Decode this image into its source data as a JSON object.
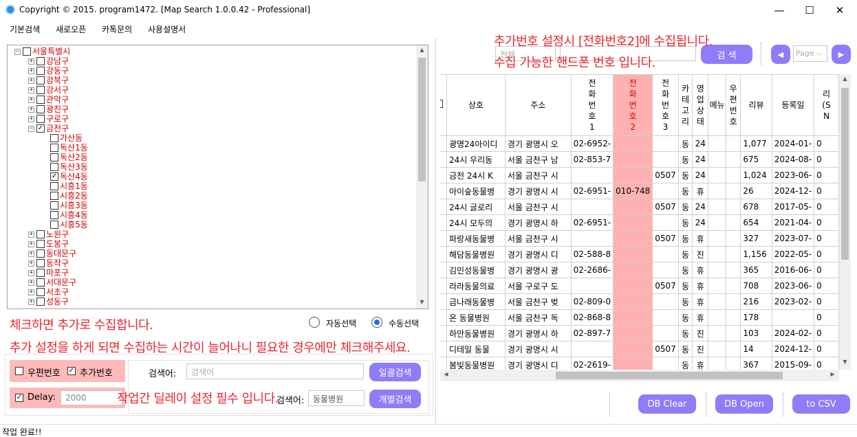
{
  "window": {
    "title": "Copyright © 2015. program1472. [Map Search 1.0.0.42 - Professional]",
    "minimize": "—",
    "maximize": "☐",
    "close": "✕"
  },
  "menu": [
    "기본검색",
    "새로오픈",
    "카톡문의",
    "사용설명서"
  ],
  "tree": {
    "root": "서울특별시",
    "districts_top": [
      "강남구",
      "강동구",
      "강북구",
      "강서구",
      "관악구",
      "광진구",
      "구로구"
    ],
    "open_district": "금천구",
    "dongs": [
      {
        "label": "가산동",
        "checked": false
      },
      {
        "label": "독산1동",
        "checked": false
      },
      {
        "label": "독산2동",
        "checked": false
      },
      {
        "label": "독산3동",
        "checked": false
      },
      {
        "label": "독산4동",
        "checked": true
      },
      {
        "label": "시흥1동",
        "checked": false
      },
      {
        "label": "시흥2동",
        "checked": false
      },
      {
        "label": "시흥3동",
        "checked": false
      },
      {
        "label": "시흥4동",
        "checked": false
      },
      {
        "label": "시흥5동",
        "checked": false
      }
    ],
    "districts_bottom": [
      "노원구",
      "도봉구",
      "동대문구",
      "동작구",
      "마포구",
      "서대문구",
      "서초구",
      "성동구"
    ]
  },
  "selection_mode": {
    "auto": "자동선택",
    "manual": "수동선택",
    "selected": "manual"
  },
  "options": {
    "postal_label": "우편번호",
    "postal_checked": false,
    "extra_label": "추가번호",
    "extra_checked": true,
    "delay_label": "Delay:",
    "delay_value": "2000",
    "delay_checked": true
  },
  "search": {
    "keyword_label": "검색어:",
    "keyword_placeholder": "검색어",
    "batch_button": "일괄검색",
    "individual_label": "검색어:",
    "individual_value": "동물병원",
    "individual_button": "개별검색"
  },
  "top_search": {
    "select_value": "전체",
    "input_placeholder": "",
    "search_button": "검  색",
    "page_select": "Page",
    "prev": "◀",
    "next": "▶"
  },
  "annotations": {
    "top_line1": "추가번호 설정시 [전화번호2]에 수집됩니다.",
    "top_line2": "수집 가능한 핸드폰 번호 입니다.",
    "check_line1": "체크하면 추가로 수집합니다.",
    "check_line2": "추가 설정을 하게 되면 수집하는 시간이 늘어나니 필요한 경우에만 체크해주세요.",
    "delay_line": "작업간 딜레이 설정 필수 입니다."
  },
  "grid": {
    "headers": [
      "",
      "상호",
      "주소",
      "전화번호1",
      "전화번호2",
      "전화번호3",
      "카테고리",
      "영업상태",
      "메뉴",
      "우편번호",
      "리뷰",
      "등록일",
      "리(SN"
    ],
    "rows": [
      [
        "광명24아이디",
        "경기 광명시 오",
        "02-6952-",
        "",
        "",
        "동",
        "24",
        "",
        "",
        "1,077",
        "2024-01-",
        "0"
      ],
      [
        "24시 우리동",
        "서울 금천구 남",
        "02-853-7",
        "",
        "",
        "동",
        "24",
        "",
        "",
        "675",
        "2024-08-",
        "0"
      ],
      [
        "금천 24시 K",
        "서울 금천구 시",
        "",
        "",
        "0507",
        "동",
        "24",
        "",
        "",
        "1,024",
        "2023-06-",
        "0"
      ],
      [
        "아이숲동물병",
        "경기 광명시 시",
        "02-6951-",
        "010-748",
        "",
        "동",
        "휴",
        "",
        "",
        "26",
        "2024-12-",
        "0"
      ],
      [
        "24시 글로리",
        "서울 금천구 시",
        "",
        "",
        "0507",
        "동",
        "24",
        "",
        "",
        "678",
        "2017-05-",
        "0"
      ],
      [
        "24시 모두의",
        "경기 광명시 하",
        "02-6951-",
        "",
        "",
        "동",
        "24",
        "",
        "",
        "654",
        "2021-04-",
        "0"
      ],
      [
        "파랑새동물병",
        "서울 금천구 시",
        "",
        "",
        "0507",
        "동",
        "휴",
        "",
        "",
        "327",
        "2023-07-",
        "0"
      ],
      [
        "해담동물병원",
        "경기 광명시 디",
        "02-588-8",
        "",
        "",
        "동",
        "진",
        "",
        "",
        "1,156",
        "2022-05-",
        "0"
      ],
      [
        "김민성동물병",
        "경기 광명시 광",
        "02-2686-",
        "",
        "",
        "동",
        "휴",
        "",
        "",
        "365",
        "2016-06-",
        "0"
      ],
      [
        "라라동물의료",
        "서울 구로구 도",
        "",
        "",
        "0507",
        "동",
        "휴",
        "",
        "",
        "708",
        "2023-06-",
        "0"
      ],
      [
        "금나래동물병",
        "서울 금천구 벚",
        "02-809-0",
        "",
        "",
        "동",
        "휴",
        "",
        "",
        "216",
        "2023-02-",
        "0"
      ],
      [
        "온 동물병원",
        "서울 금천구 독",
        "02-868-8",
        "",
        "",
        "동",
        "휴",
        "",
        "",
        "178",
        "",
        "0"
      ],
      [
        "하안동물병원",
        "경기 광명시 하",
        "02-897-7",
        "",
        "",
        "동",
        "진",
        "",
        "",
        "103",
        "2024-02-",
        "0"
      ],
      [
        "디테일 동물",
        "경기 광명시 시",
        "",
        "",
        "0507",
        "동",
        "진",
        "",
        "",
        "14",
        "2024-12-",
        "0"
      ],
      [
        "봄빛동물병원",
        "경기 광명시 디",
        "02-2619-",
        "",
        "",
        "동",
        "휴",
        "",
        "",
        "367",
        "2015-09-",
        "0"
      ]
    ]
  },
  "db_buttons": {
    "clear": "DB Clear",
    "open": "DB Open",
    "csv": "to CSV"
  },
  "status": "작업 완료!!",
  "colors": {
    "accent": "#8f7cf7",
    "annotation": "#e8262e",
    "highlight": "#ffb1b1",
    "tree_label": "#d00000"
  }
}
